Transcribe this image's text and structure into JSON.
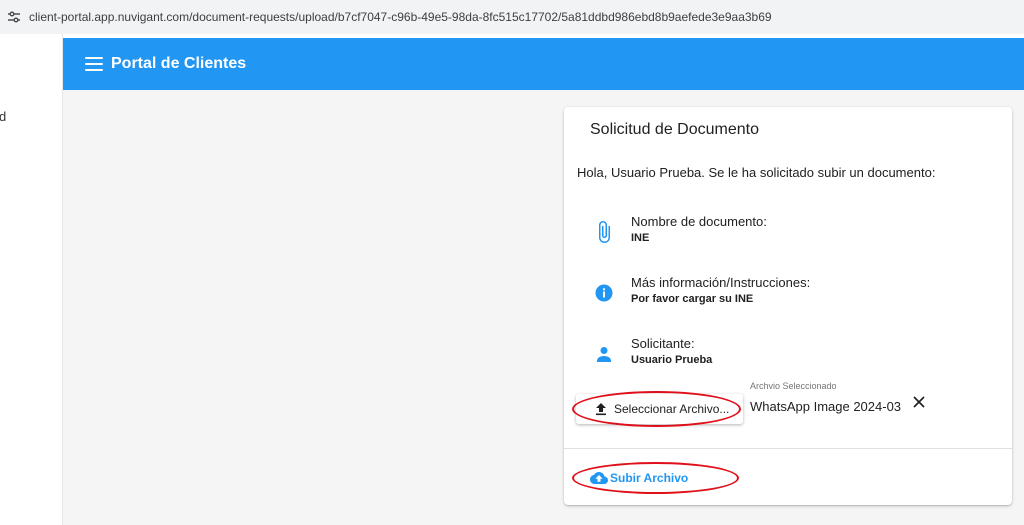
{
  "browser": {
    "url": "client-portal.app.nuvigant.com/document-requests/upload/b7cf7047-c96b-49e5-98da-8fc515c17702/5a81ddbd986ebd8b9aefede3e9aa3b69",
    "site_icon": "tune-icon"
  },
  "left_pane": {
    "fragment_text": "d"
  },
  "app_bar": {
    "title": "Portal de Clientes",
    "menu_icon": "menu-icon",
    "color": "#2196f3"
  },
  "card": {
    "title": "Solicitud de Documento",
    "greeting": "Hola, Usuario Prueba. Se le ha solicitado subir un documento:",
    "rows": [
      {
        "icon": "paperclip-icon",
        "label": "Nombre de documento:",
        "value": "INE"
      },
      {
        "icon": "info-icon",
        "label": "Más información/Instrucciones:",
        "value": "Por favor cargar su INE"
      },
      {
        "icon": "person-icon",
        "label": "Solicitante:",
        "value": "Usuario Prueba"
      }
    ],
    "select_button": {
      "label": "Seleccionar Archivo...",
      "icon": "upload-icon"
    },
    "selected_file": {
      "caption": "Archvio Seleccionado",
      "name": "WhatsApp Image 2024-03",
      "clear_icon": "close-icon"
    },
    "upload_button": {
      "label": "Subir Archivo",
      "icon": "cloud-upload-icon"
    }
  },
  "colors": {
    "accent": "#2196f3",
    "highlight": "#e0101a",
    "background": "#f5f5f5"
  }
}
